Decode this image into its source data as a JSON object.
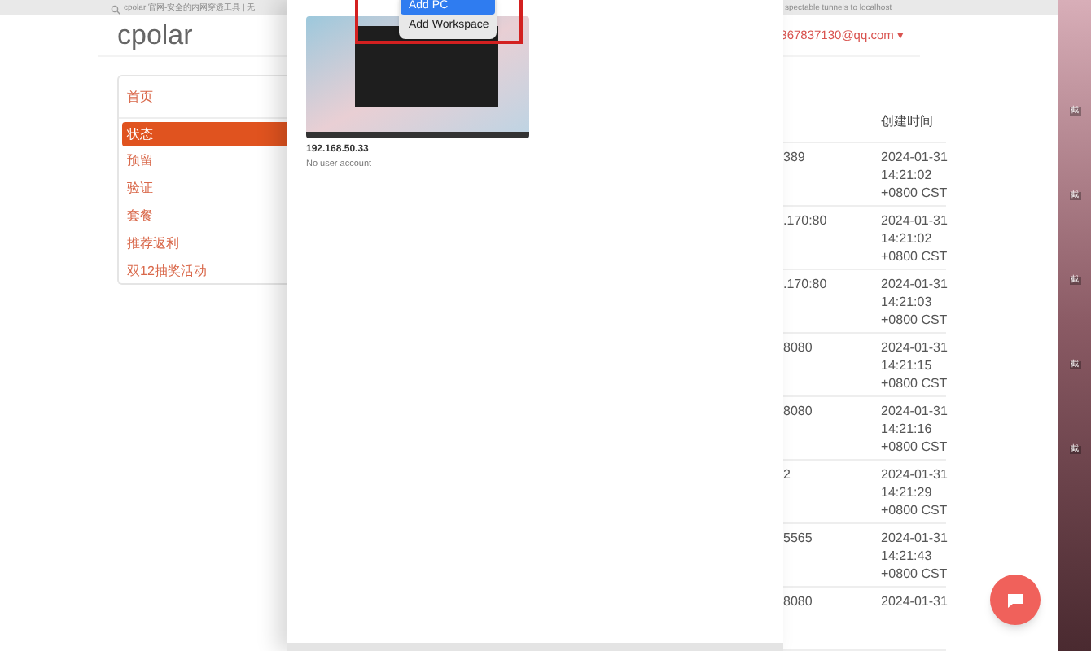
{
  "browser": {
    "address_left": "cpolar 官网-安全的内网穿透工具 | 无",
    "address_right": "spectable tunnels to localhost"
  },
  "site": {
    "logo": "cpolar",
    "account": "367837130@qq.com",
    "account_caret": "▾"
  },
  "nav": [
    {
      "label": "首页",
      "selected": false
    },
    {
      "label": "状态",
      "selected": true
    },
    {
      "label": "预留",
      "selected": false
    },
    {
      "label": "验证",
      "selected": false
    },
    {
      "label": "套餐",
      "selected": false
    },
    {
      "label": "推荐返利",
      "selected": false
    },
    {
      "label": "双12抽奖活动",
      "selected": false
    }
  ],
  "table": {
    "columns": [
      "创建时间"
    ],
    "rows": [
      {
        "column_1": "389",
        "created": [
          "2024-01-31",
          "14:21:02",
          "+0800 CST"
        ]
      },
      {
        "column_1": ".170:80",
        "created": [
          "2024-01-31",
          "14:21:02",
          "+0800 CST"
        ]
      },
      {
        "column_1": ".170:80",
        "created": [
          "2024-01-31",
          "14:21:03",
          "+0800 CST"
        ]
      },
      {
        "column_1": "8080",
        "created": [
          "2024-01-31",
          "14:21:15",
          "+0800 CST"
        ]
      },
      {
        "column_1": "8080",
        "created": [
          "2024-01-31",
          "14:21:16",
          "+0800 CST"
        ]
      },
      {
        "column_1": "2",
        "created": [
          "2024-01-31",
          "14:21:29",
          "+0800 CST"
        ]
      },
      {
        "column_1": "5565",
        "created": [
          "2024-01-31",
          "14:21:43",
          "+0800 CST"
        ]
      },
      {
        "column_1": "8080",
        "created": [
          "2024-01-31"
        ]
      }
    ]
  },
  "remote_desktop": {
    "menu": [
      {
        "label": "Add PC",
        "selected": true
      },
      {
        "label": "Add Workspace",
        "selected": false
      }
    ],
    "pc": {
      "name": "192.168.50.33",
      "account": "No user account"
    }
  },
  "desktop": {
    "icon_labels": [
      "截",
      "截",
      "截",
      "截",
      "截"
    ]
  }
}
